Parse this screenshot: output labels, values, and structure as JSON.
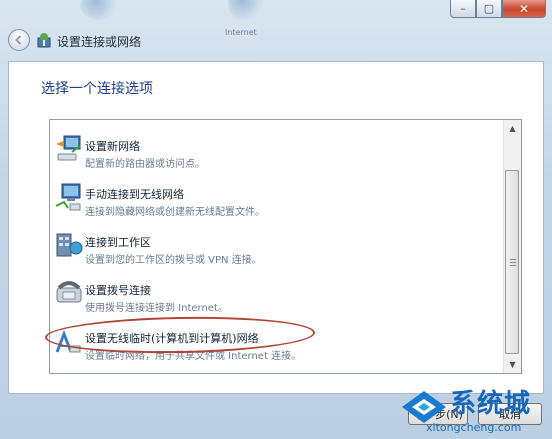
{
  "window": {
    "title": "设置连接或网络",
    "ghost_text": "Internet"
  },
  "caption_buttons": {
    "minimize": "–",
    "maximize": "▢",
    "close": "✕"
  },
  "content": {
    "heading": "选择一个连接选项",
    "options": [
      {
        "title": "设置新网络",
        "desc": "配置新的路由器或访问点。",
        "icon": "new-network-icon"
      },
      {
        "title": "手动连接到无线网络",
        "desc": "连接到隐藏网络或创建新无线配置文件。",
        "icon": "wireless-network-icon"
      },
      {
        "title": "连接到工作区",
        "desc": "设置到您的工作区的拨号或 VPN 连接。",
        "icon": "workplace-icon"
      },
      {
        "title": "设置拨号连接",
        "desc": "使用拨号连接连接到 Internet。",
        "icon": "dialup-phone-icon"
      },
      {
        "title": "设置无线临时(计算机到计算机)网络",
        "desc": "设置临时网络，用于共享文件或 Internet 连接。",
        "icon": "adhoc-network-icon"
      }
    ]
  },
  "footer": {
    "next_label": "下一步(N)",
    "cancel_label": "取消"
  },
  "watermark": {
    "brand": "系统城",
    "url": "xitongcheng.com"
  },
  "colors": {
    "heading": "#1d3f8c",
    "highlight_oval": "#b04436",
    "watermark": "#1766b8"
  }
}
